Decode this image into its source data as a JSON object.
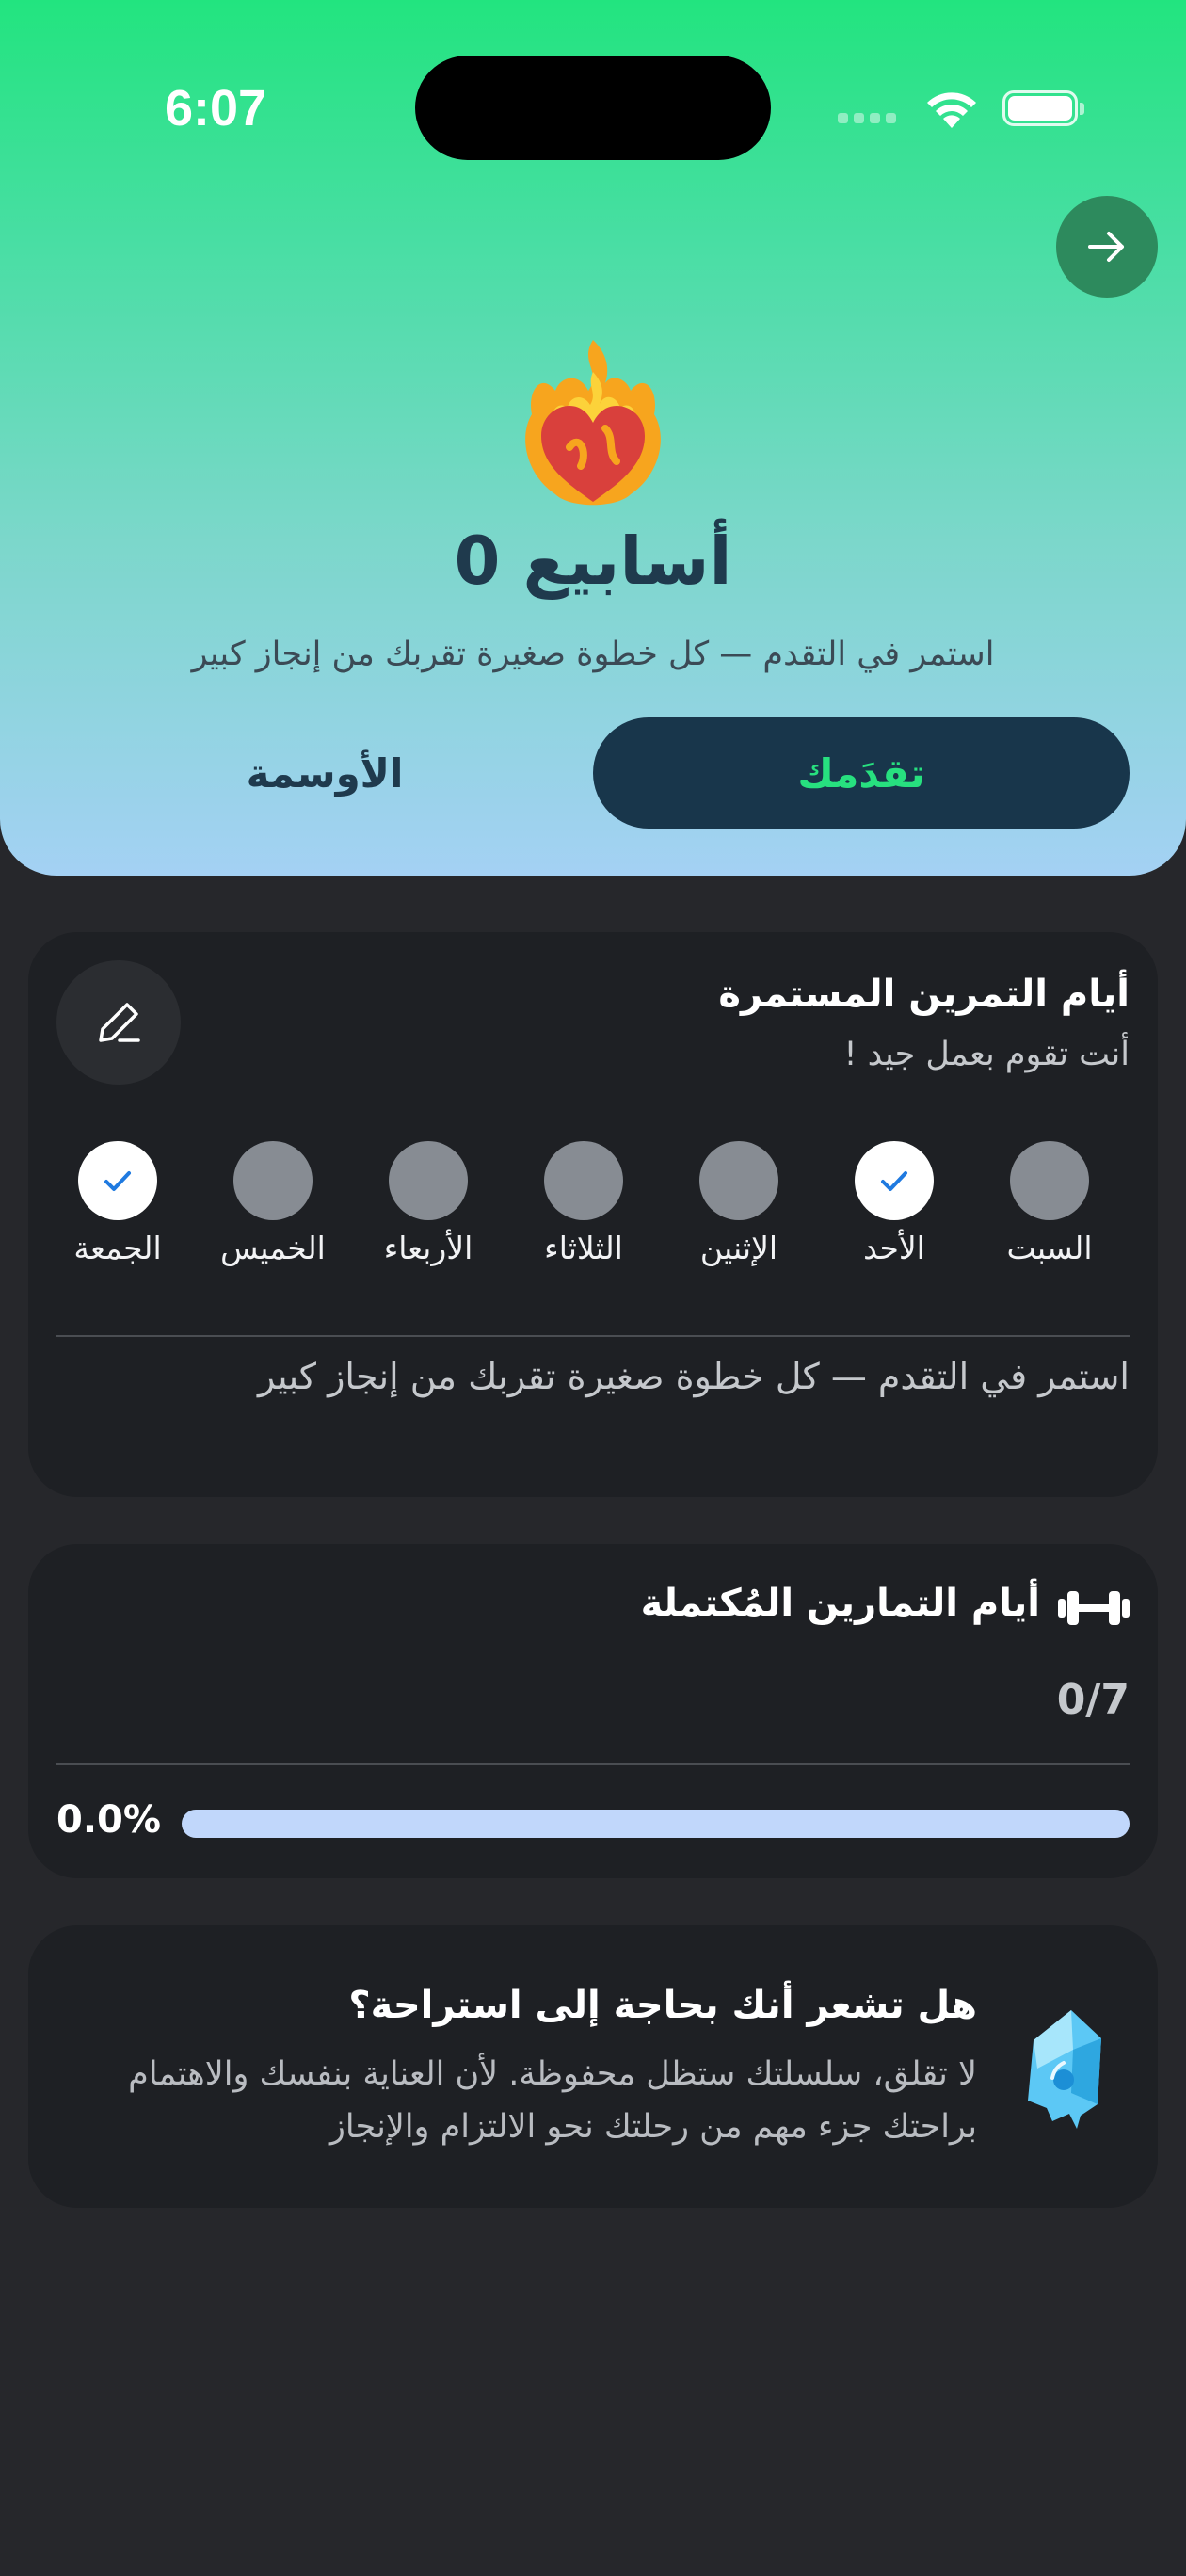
{
  "status_bar": {
    "time": "6:07"
  },
  "header": {
    "streak_title": "0 أسابيع",
    "streak_subtitle": "استمر في التقدم — كل خطوة صغيرة تقربك من إنجاز كبير",
    "tabs": [
      {
        "label": "تقدَمك",
        "active": true
      },
      {
        "label": "الأوسمة",
        "active": false
      }
    ],
    "colors": {
      "gradient_top": "#22e47f",
      "gradient_bottom": "#a4d1f4",
      "active_tab_bg": "#18364b",
      "active_tab_text": "#27e07f"
    }
  },
  "streak_card": {
    "title": "أيام التمرين المستمرة",
    "subtitle": "أنت تقوم بعمل جيد !",
    "edit_icon": "pencil-icon",
    "days": [
      {
        "label": "السبت",
        "done": false
      },
      {
        "label": "الأحد",
        "done": true
      },
      {
        "label": "الإثنين",
        "done": false
      },
      {
        "label": "الثلاثاء",
        "done": false
      },
      {
        "label": "الأربعاء",
        "done": false
      },
      {
        "label": "الخميس",
        "done": false
      },
      {
        "label": "الجمعة",
        "done": true
      }
    ],
    "motto": "استمر في التقدم — كل خطوة صغيرة تقربك من إنجاز كبير"
  },
  "completed_card": {
    "title": "أيام التمارين المُكتملة",
    "icon": "dumbbell-icon",
    "count": "0/7",
    "percent_label": "0.0%",
    "progress_fraction": 0.0
  },
  "rest_card": {
    "title": "هل تشعر أنك بحاجة إلى استراحة؟",
    "body": "لا تقلق، سلسلتك ستظل محفوظة. لأن العناية بنفسك والاهتمام براحتك جزء مهم من رحلتك نحو الالتزام والإنجاز",
    "icon": "ice-cube-icon"
  }
}
